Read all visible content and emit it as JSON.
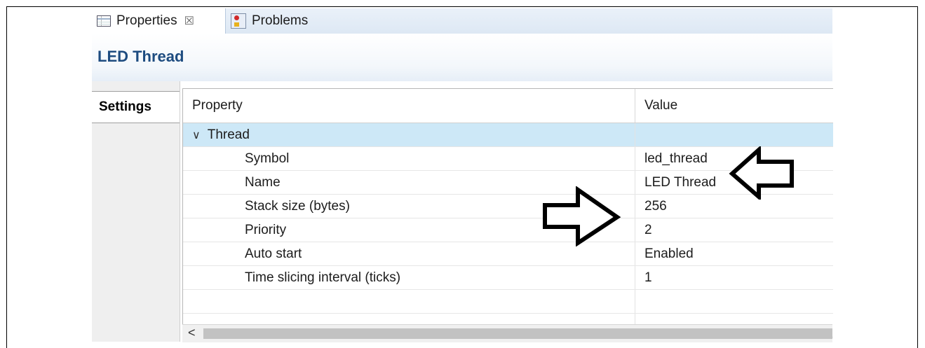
{
  "tabs": [
    {
      "label": "Properties",
      "icon": "properties-icon",
      "active": true
    },
    {
      "label": "Problems",
      "icon": "problems-icon",
      "active": false
    }
  ],
  "close_glyph": "☒",
  "title": "LED Thread",
  "left_tabs": [
    {
      "label": "Settings"
    }
  ],
  "table": {
    "columns": [
      "Property",
      "Value"
    ],
    "group": {
      "label": "Thread",
      "expanded": true
    },
    "rows": [
      {
        "property": "Symbol",
        "value": "led_thread"
      },
      {
        "property": "Name",
        "value": "LED Thread"
      },
      {
        "property": "Stack size (bytes)",
        "value": "256"
      },
      {
        "property": "Priority",
        "value": "2"
      },
      {
        "property": "Auto start",
        "value": "Enabled"
      },
      {
        "property": "Time slicing interval (ticks)",
        "value": "1"
      }
    ]
  },
  "scrollbar": {
    "left_arrow": "<"
  },
  "colors": {
    "title": "#1e4c80",
    "group_row": "#cde8f7"
  }
}
